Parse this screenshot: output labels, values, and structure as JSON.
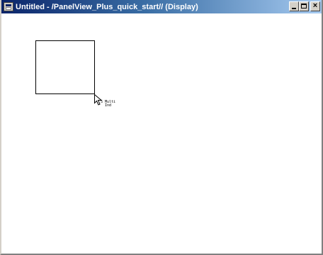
{
  "window": {
    "title": "Untitled - /PanelView_Plus_quick_start// (Display)",
    "controls": {
      "minimize_icon": "minimize-icon",
      "maximize_icon": "maximize-icon",
      "close_glyph": "×"
    }
  },
  "canvas": {
    "background": "#ffffff",
    "objects": [
      {
        "type": "rectangle",
        "border_color": "#000000"
      }
    ],
    "cursor": {
      "icon": "arrow-cursor-icon",
      "tooltip_line1": "S Multi",
      "tooltip_line2": "Ind"
    }
  },
  "colors": {
    "titlebar_start": "#0a246a",
    "titlebar_end": "#a6caf0",
    "frame": "#d4d0c8"
  }
}
